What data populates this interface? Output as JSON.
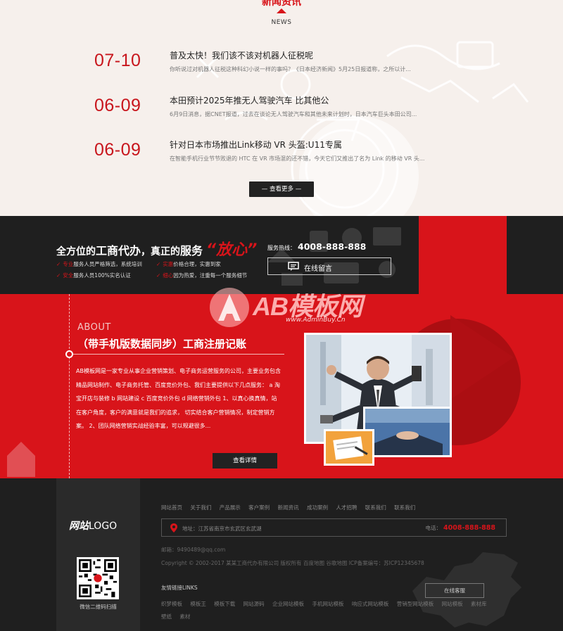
{
  "news": {
    "title": "新闻资讯",
    "subtitle": "NEWS",
    "items": [
      {
        "date": "07-10",
        "title": "普及太快！我们该不该对机器人征税呢",
        "desc": "你听说过对机器人征税这种科幻小说一样的事吗？《日本经济新闻》5月25日报道称，之所以计..."
      },
      {
        "date": "06-09",
        "title": "本田预计2025年推无人驾驶汽车 比其他公",
        "desc": "6月9日消息，据CNET报道，过去在谈论无人驾驶汽车和其他未来计划时，日本汽车巨头本田公司..."
      },
      {
        "date": "06-09",
        "title": "针对日本市场推出Link移动 VR 头盔:U11专属",
        "desc": "在智能手机行业节节败退的 HTC 在 VR 市场混的还不错，今天它们又推出了名为 Link 的移动 VR 头..."
      }
    ],
    "more_label": "— 查看更多 —"
  },
  "strip": {
    "title_a": "全方位的",
    "title_b": "工商代办",
    "title_c": "，真正的",
    "title_d": "服务",
    "title_big": "“放心”",
    "features": [
      {
        "hl": "专业",
        "text": "服务人员严格筛选，系统培训"
      },
      {
        "hl": "实惠",
        "text": "价格合理，实惠到家"
      },
      {
        "hl": "安全",
        "text": "服务人员100%实名认证"
      },
      {
        "hl": "细心",
        "text": "因为热爱，注重每一个服务细节"
      }
    ],
    "hotline_label": "服务热线：",
    "hotline": "4008-888-888",
    "message_label": "在线留言"
  },
  "about": {
    "en": "ABOUT",
    "title": "（带手机版数据同步）工商注册记账",
    "text": "AB模板网是一家专业从事企业营销策划、电子商务运营服务的公司，主要业务包含精品网站制作、电子商务托管、百度竞价外包、我们主要提供以下几点服务： a 淘宝开店与装修 b 网站建设 c 百度竞价外包 d 网络营销外包 1、以真心换真情，站在客户角度，客户的满意就是我们的追求， 切实结合客户营销情况，制定营销方案。 2、团队网络营销实战经验丰富，可以规避很多...",
    "detail_label": "查看详情",
    "watermark": "AB模板网",
    "watermark_url": "www.AdminBuy.Cn"
  },
  "footer": {
    "logo_cn": "网站",
    "logo_en": "LOGO",
    "qr_label": "微信二维码扫描",
    "nav": [
      "网站首页",
      "关于我们",
      "产品展示",
      "客户案例",
      "新闻资讯",
      "成功案例",
      "人才招聘",
      "联系我们",
      "联系我们"
    ],
    "address": "地址：江苏省南京市玄武区玄武湖",
    "tel_label": "电话：",
    "tel": "4008-888-888",
    "email": "邮箱：9490489@qq.com",
    "copyright": "Copyright © 2002-2017 某某工商代办有限公司 版权所有   百度地图   谷歌地图   ICP备案编号：苏ICP12345678",
    "links_title": "友情链接LINKS",
    "links": [
      "织梦模板",
      "模板王",
      "模板下载",
      "网站源码",
      "企业网站模板",
      "手机网站模板",
      "响应式网站模板",
      "营销型网站模板",
      "网站模板",
      "素材库",
      "壁纸",
      "素材"
    ],
    "online_label": "在线客服"
  },
  "colors": {
    "accent": "#d8141a",
    "dark": "#1f1f1f",
    "news_bg": "#f6f0ec"
  }
}
